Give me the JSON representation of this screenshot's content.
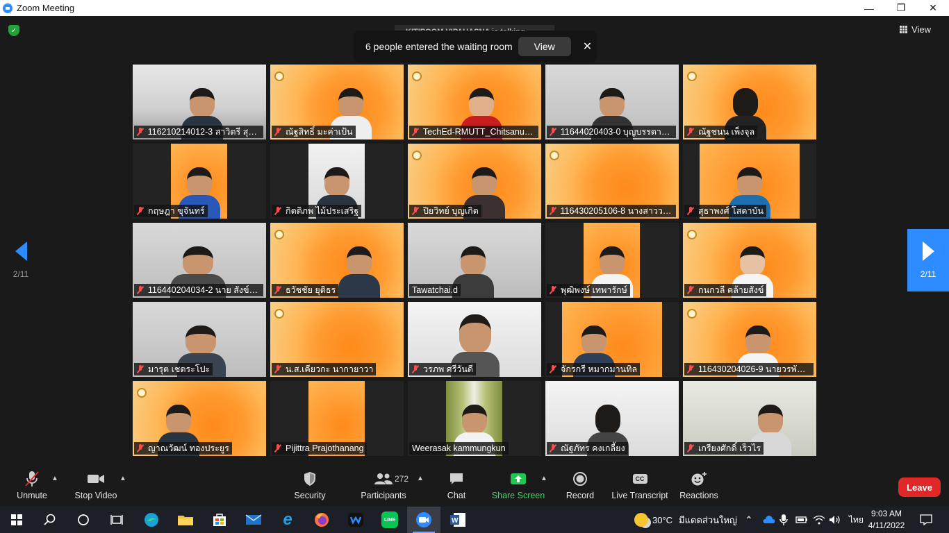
{
  "window": {
    "title": "Zoom Meeting",
    "minimize": "—",
    "maximize": "❐",
    "close": "✕"
  },
  "top": {
    "view_label": "View",
    "talking": "KITIPOOM VIPAHASNA is talking...",
    "notice": {
      "message": "6 people entered the waiting room",
      "view_label": "View",
      "close": "✕"
    }
  },
  "pager": {
    "left": "2/11",
    "right": "2/11"
  },
  "tiles": [
    {
      "name": "116210214012-3 สาวิตรี สุวร..."
    },
    {
      "name": "ณัฐสิทธิ์ มะค่าเป้น"
    },
    {
      "name": "TechEd-RMUTT_Chitsanup..."
    },
    {
      "name": "11644020403-0 บุญบรรตาล ..."
    },
    {
      "name": "ณัฐชนน เพ็งจุล"
    },
    {
      "name": "กฤษฎา ขุจันทร์"
    },
    {
      "name": "กิตติภพ ไม้ประเสริฐ"
    },
    {
      "name": "ปิยวิทย์ บุญเกิด"
    },
    {
      "name": "116430205106-8 นางสาววรร..."
    },
    {
      "name": "สุธาพงศ์ โสดาบัน"
    },
    {
      "name": "116440204034-2 นาย สังข์ชั..."
    },
    {
      "name": "ธวัชชัย ยุติธร"
    },
    {
      "name": "Tawatchai.d"
    },
    {
      "name": "พุฒิพงษ์ เทพารักษ์"
    },
    {
      "name": "กนกวลี คล้ายสังข์"
    },
    {
      "name": "มารุต เชตระโปะ"
    },
    {
      "name": "น.ส.เคียวกะ นากายาวา"
    },
    {
      "name": "วรภพ ศรีวันดี"
    },
    {
      "name": "จักรกรี หมากมานทิล"
    },
    {
      "name": "116430204026-9 นายวรพัฒ..."
    },
    {
      "name": "ญาณวัฒน์ ทองประยูร"
    },
    {
      "name": "Pijittra Prajothanang"
    },
    {
      "name": "Weerasak kammungkun"
    },
    {
      "name": "ณัฐภัทร คงเกลี้ยง"
    },
    {
      "name": "เกรียงศักดิ์ เร็วไร"
    }
  ],
  "toolbar": {
    "unmute": "Unmute",
    "stop_video": "Stop Video",
    "security": "Security",
    "participants": "Participants",
    "participants_count": "272",
    "chat": "Chat",
    "share_screen": "Share Screen",
    "record": "Record",
    "live_transcript": "Live Transcript",
    "reactions": "Reactions",
    "leave": "Leave",
    "cc": "CC"
  },
  "taskbar": {
    "weather_temp": "30°C",
    "weather_text": "มีแดดส่วนใหญ่",
    "lang": "ไทย",
    "time": "9:03 AM",
    "date": "4/11/2022"
  },
  "colors": {
    "accent": "#2d8cff",
    "leave": "#e02828",
    "share_green": "#23c552"
  }
}
